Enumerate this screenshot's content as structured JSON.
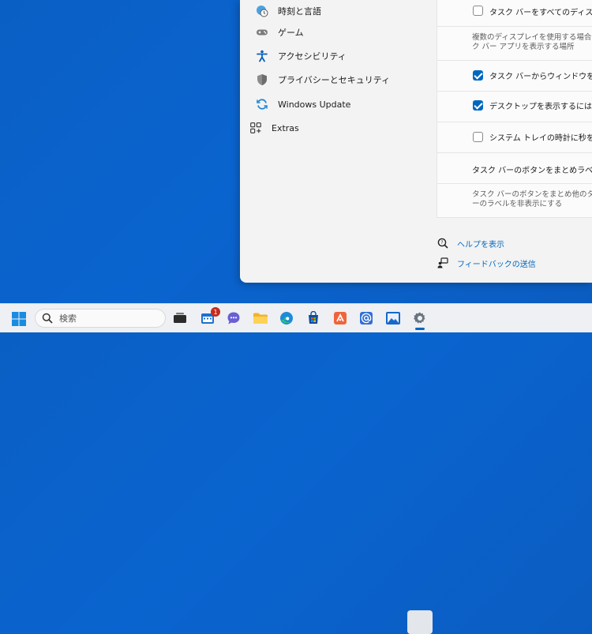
{
  "nav": {
    "items": [
      {
        "label": "時刻と言語",
        "icon": "globe-clock-icon"
      },
      {
        "label": "ゲーム",
        "icon": "gamepad-icon"
      },
      {
        "label": "アクセシビリティ",
        "icon": "accessibility-icon"
      },
      {
        "label": "プライバシーとセキュリティ",
        "icon": "shield-icon"
      },
      {
        "label": "Windows Update",
        "icon": "sync-icon"
      },
      {
        "label": "Extras",
        "icon": "grid-add-icon"
      }
    ]
  },
  "settings": {
    "all_displays": {
      "label": "タスク バーをすべてのディスプレイ",
      "checked": false
    },
    "multi_display_desc": "複数のディスプレイを使用する場合に タスク バー アプリを表示する場所",
    "share_window": {
      "label": "タスク バーからウィンドウを共有す",
      "checked": true
    },
    "show_desktop": {
      "label": "デスクトップを表示するには、タス",
      "checked": true
    },
    "tray_seconds": {
      "label": "システム トレイの時計に秒を表示",
      "checked": false
    },
    "combine_buttons": {
      "label": "タスク バーのボタンをまとめラベルを非"
    },
    "combine_other_desc": "タスク バーのボタンをまとめ他のタスク バーのラベルを非表示にする"
  },
  "links": {
    "help": "ヘルプを表示",
    "feedback": "フィードバックの送信"
  },
  "taskbar": {
    "search_placeholder": "検索",
    "mail_badge": "1"
  },
  "colors": {
    "accent": "#0067c0",
    "desktop": "#0a5fc4"
  }
}
